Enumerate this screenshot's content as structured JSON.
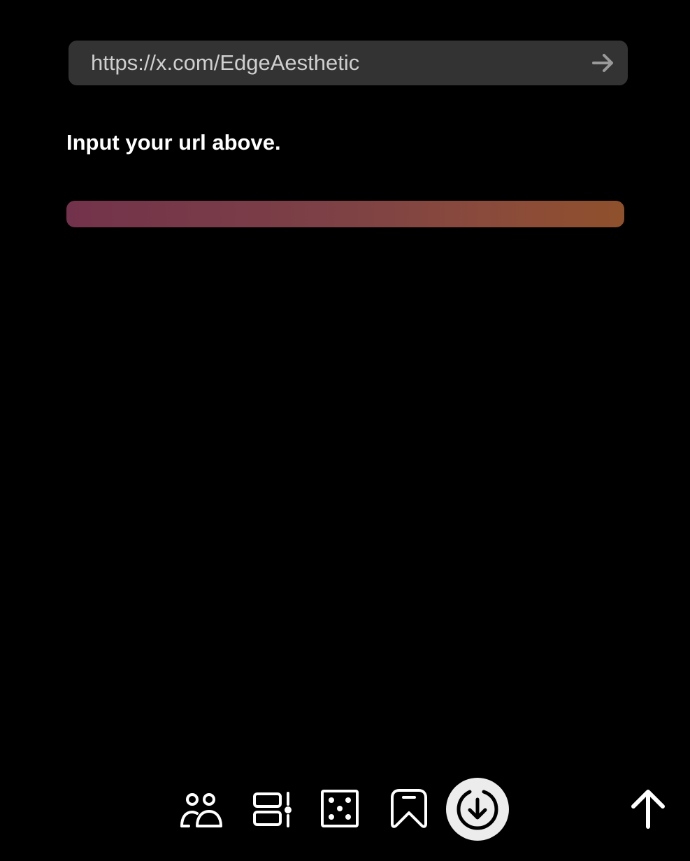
{
  "url_bar": {
    "value": "https://x.com/EdgeAesthetic",
    "go_icon": "arrow-right-icon"
  },
  "hint_text": "Input your url above.",
  "gradient": {
    "start_color": "#73324b",
    "end_color": "#8f502c"
  },
  "bottom_nav": {
    "items": [
      {
        "icon": "people-icon"
      },
      {
        "icon": "layout-list-icon"
      },
      {
        "icon": "dice-icon"
      },
      {
        "icon": "bookmark-icon"
      },
      {
        "icon": "download-circle-icon",
        "active": true
      },
      {
        "icon": "arrow-up-icon"
      }
    ]
  },
  "colors": {
    "background": "#000000",
    "url_bar_bg": "#333333",
    "url_text": "#cfcfcf",
    "active_nav_bg": "#ececec"
  }
}
